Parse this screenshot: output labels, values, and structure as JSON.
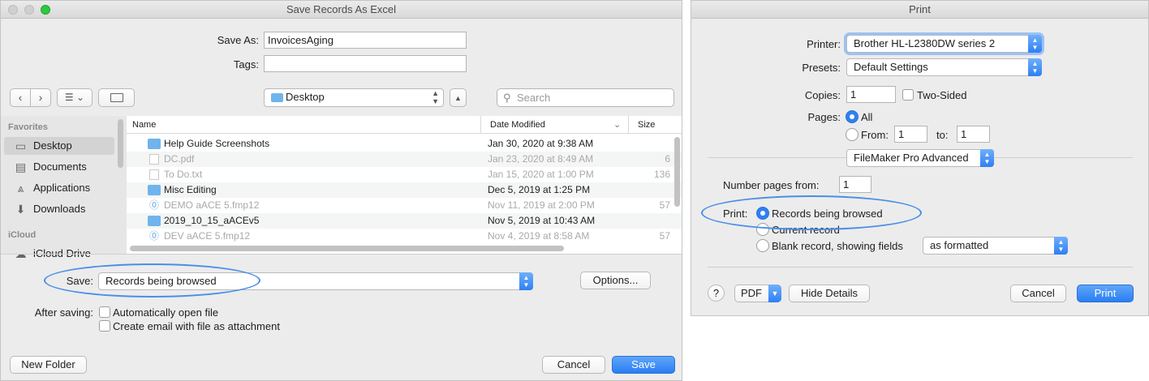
{
  "save_dialog": {
    "title": "Save Records As Excel",
    "save_as_label": "Save As:",
    "save_as_value": "InvoicesAging",
    "tags_label": "Tags:",
    "tags_value": "",
    "location": "Desktop",
    "search_placeholder": "Search",
    "sidebar": {
      "favorites_label": "Favorites",
      "favorites": [
        "Desktop",
        "Documents",
        "Applications",
        "Downloads"
      ],
      "icloud_label": "iCloud",
      "icloud": [
        "iCloud Drive"
      ]
    },
    "columns": {
      "name": "Name",
      "date": "Date Modified",
      "size": "Size"
    },
    "files": [
      {
        "name": "Help Guide Screenshots",
        "date": "Jan 30, 2020 at 9:38 AM",
        "size": "",
        "kind": "folder",
        "dimmed": false
      },
      {
        "name": "DC.pdf",
        "date": "Jan 23, 2020 at 8:49 AM",
        "size": "6",
        "kind": "pdf",
        "dimmed": true
      },
      {
        "name": "To Do.txt",
        "date": "Jan 15, 2020 at 1:00 PM",
        "size": "136",
        "kind": "txt",
        "dimmed": true
      },
      {
        "name": "Misc Editing",
        "date": "Dec 5, 2019 at 1:25 PM",
        "size": "",
        "kind": "folder",
        "dimmed": false
      },
      {
        "name": "DEMO aACE 5.fmp12",
        "date": "Nov 11, 2019 at 2:00 PM",
        "size": "57",
        "kind": "fmp",
        "dimmed": true
      },
      {
        "name": "2019_10_15_aACEv5",
        "date": "Nov 5, 2019 at 10:43 AM",
        "size": "",
        "kind": "folder",
        "dimmed": false
      },
      {
        "name": "DEV aACE 5.fmp12",
        "date": "Nov 4, 2019 at 8:58 AM",
        "size": "57",
        "kind": "fmp",
        "dimmed": true
      }
    ],
    "save_label": "Save:",
    "save_value": "Records being browsed",
    "options_button": "Options...",
    "after_saving_label": "After saving:",
    "auto_open_label": "Automatically open file",
    "create_email_label": "Create email with file as attachment",
    "new_folder_button": "New Folder",
    "cancel_button": "Cancel",
    "save_button": "Save"
  },
  "print_dialog": {
    "title": "Print",
    "printer_label": "Printer:",
    "printer_value": "Brother HL-L2380DW series 2",
    "presets_label": "Presets:",
    "presets_value": "Default Settings",
    "copies_label": "Copies:",
    "copies_value": "1",
    "two_sided_label": "Two-Sided",
    "pages_label": "Pages:",
    "pages_all": "All",
    "pages_from": "From:",
    "pages_from_value": "1",
    "pages_to": "to:",
    "pages_to_value": "1",
    "app_section": "FileMaker Pro Advanced",
    "number_pages_label": "Number pages from:",
    "number_pages_value": "1",
    "print_label": "Print:",
    "print_options": [
      "Records being browsed",
      "Current record",
      "Blank record, showing fields"
    ],
    "blank_record_format": "as formatted",
    "help_button": "?",
    "pdf_button": "PDF",
    "hide_details_button": "Hide Details",
    "cancel_button": "Cancel",
    "print_button": "Print"
  },
  "colors": {
    "accent": "#2f7ff4",
    "highlight_ellipse": "#4a8ee8"
  }
}
